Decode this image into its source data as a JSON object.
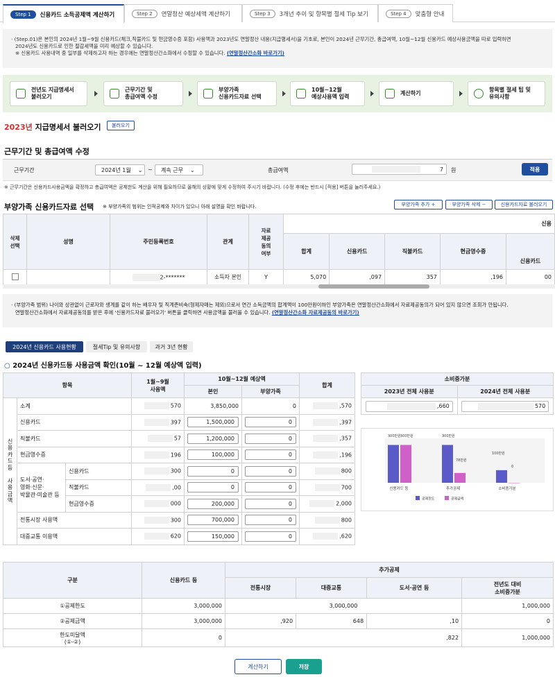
{
  "tabs": [
    {
      "step": "Step 1",
      "label": "신용카드 소득공제액 계산하기"
    },
    {
      "step": "Step 2",
      "label": "연말정산 예상세액 계산하기"
    },
    {
      "step": "Step 3",
      "label": "3개년 추이 및 항목별 절세 Tip 보기"
    },
    {
      "step": "Step 4",
      "label": "맞춤형 안내"
    }
  ],
  "notice": {
    "line1": "· (Step.01)은 본인의 2024년 1월~9월 신용카드(체크,직불카드 및 현금영수증 포함) 사용액과 2023년도 연말정산 내용(지급명세서)을 기초로, 본인이 2024년 근무기간, 총급여액, 10월~12월 신용카드 예상사용금액을 따로 입력하면",
    "line2": "2024년도 신용카드로 인한 절감세액을 미리 예상할 수 있습니다.",
    "line3": "※ 신용카드 사용내역 중 일부를 삭제하고자 하는 경우에는 연말정산간소화에서 수정할 수 있습니다.",
    "link": "(연말정산간소화 바로가기)"
  },
  "flow": [
    {
      "l1": "전년도 지급명세서",
      "l2": "불러오기"
    },
    {
      "l1": "근무기간 및",
      "l2": "총급여액 수정"
    },
    {
      "l1": "부양가족",
      "l2": "신용카드자료 선택"
    },
    {
      "l1": "10월~12월",
      "l2": "예상사용액 입력"
    },
    {
      "l1": "계산하기",
      "l2": ""
    },
    {
      "l1": "항목별 절세 팁 및",
      "l2": "유의사항"
    }
  ],
  "sec1": {
    "year": "2023년",
    "title": " 지급명세서 불러오기",
    "button": "불러오기"
  },
  "sec2": {
    "title": "근무기간 및 총급여액 수정",
    "period_label": "근무기간",
    "period_from": "2024년 1월",
    "tilde": "~",
    "period_to": "계속 근무",
    "salary_label": "총급여액",
    "salary_value": "7",
    "salary_unit": "원",
    "apply": "적용",
    "note": "※ 근무기간은 신용카드사용금액을 확정하고 총급여액은 공제한도 계산을 위해 필요하므로 올해의 상황에 맞게 수정하여 주시기 바랍니다. (수정 후에는 반드시 [적용] 버튼을 눌러주세요.)"
  },
  "sec3": {
    "title": "부양가족 신용카드자료 선택",
    "subnote": "※ 부양가족의 범위는 인적공제와 차이가 있으니 아래 설명을 확인 바랍니다.",
    "btn_add": "부양가족 추가 +",
    "btn_del": "부양가족 삭제 −",
    "btn_load": "신용카드자료 불러오기",
    "headers": {
      "del": "삭제\n선택",
      "name": "성명",
      "rrn": "주민등록번호",
      "rel": "관계",
      "consent": "자료\n제공\n동의\n여부",
      "sum": "합계",
      "credit": "신용카드",
      "debit": "직불카드",
      "cash": "현금영수증",
      "credit2": "신용카드",
      "group": "신용"
    },
    "row": {
      "rrn": "2-*******",
      "rel": "소득자 본인",
      "consent": "Y",
      "sum": "5,070",
      "credit": ",097",
      "debit": "357",
      "cash": ",196",
      "credit2": "00"
    }
  },
  "note2": {
    "line1": "· (부양가족 범위) 나이와 상관없이 근로자와 생계를 같이 하는 배우자 및 직계존비속(형제자매는 제외)으로서 연간 소득금액의 합계액이 100만원이하인 부양가족은 연말정산간소화에서 자료제공동의가 되어 있지 않으면 조회가 안됩니다.",
    "line2": "연말정산간소화에서 자료제공동의를 받은 후에 '신용카드자료 불러오기' 버튼을 클릭하면 사용금액을 불러올 수 있습니다.",
    "link": "(연말정산간소화 자료제공동의 바로가기)"
  },
  "subtabs": [
    "2024년 신용카드 사용현황",
    "절세Tip 및 유의사항",
    "과거 3년 현황"
  ],
  "sec4": {
    "title": "2024년 신용카드등 사용금액 확인(10월 ~ 12월 예상액 입력)",
    "h_item": "항목",
    "h_jan": "1월~9월\n사용액",
    "h_oct": "10월~12월 예상액",
    "h_self": "본인",
    "h_fam": "부양가족",
    "h_total": "합계",
    "side": "신\n용\n카\n드\n등\n\n사\n용\n금\n액",
    "rows": [
      {
        "label": "소계",
        "sub": "",
        "jan": "570",
        "self": "3,850,000",
        "fam": "0",
        "total": ",570",
        "input": false
      },
      {
        "label": "신용카드",
        "sub": "",
        "jan": "397",
        "self": "1,500,000",
        "fam": "0",
        "total": ",397",
        "input": true
      },
      {
        "label": "직불카드",
        "sub": "",
        "jan": "57",
        "self": "1,200,000",
        "fam": "0",
        "total": ",357",
        "input": true
      },
      {
        "label": "현금영수증",
        "sub": "",
        "jan": "196",
        "self": "100,000",
        "fam": "0",
        "total": ",196",
        "input": true
      },
      {
        "label": "",
        "sub": "신용카드",
        "jan": "300",
        "self": "0",
        "fam": "0",
        "total": "800",
        "input": true
      },
      {
        "label": "",
        "sub": "직불카드",
        "jan": ",00",
        "self": "0",
        "fam": "0",
        "total": "700",
        "input": true
      },
      {
        "label": "",
        "sub": "현금영수증",
        "jan": "000",
        "self": "200,000",
        "fam": "0",
        "total": "2,000",
        "input": true
      },
      {
        "label": "전통시장 사용액",
        "sub": "",
        "jan": "300",
        "self": "700,000",
        "fam": "0",
        "total": "800",
        "input": true
      },
      {
        "label": "대중교통 이용액",
        "sub": "",
        "jan": "620",
        "self": "150,000",
        "fam": "0",
        "total": ",620",
        "input": true
      }
    ],
    "culture": "도서·공연·\n영화·신문·\n박물관·미술관 등"
  },
  "consume": {
    "title": "소비증가분",
    "h2023": "2023년 전체 사용분",
    "h2024": "2024년 전체 사용분",
    "v2023": ",660",
    "v2024": "570"
  },
  "chart_data": {
    "type": "bar",
    "categories": [
      "신용카드 등",
      "추가공제",
      "소비증가분"
    ],
    "series": [
      {
        "name": "공제한도",
        "values": [
          300,
          300,
          100
        ],
        "color": "#5a5ac8"
      },
      {
        "name": "공제금액",
        "values": [
          300,
          78,
          0
        ],
        "color": "#d060c8"
      }
    ],
    "labels": [
      "300만원",
      "300만원",
      "300만원",
      "78만원",
      "100만원",
      "0"
    ],
    "ylim": [
      0,
      330
    ]
  },
  "sec5": {
    "h_div": "구분",
    "h_card": "신용카드 등",
    "h_extra": "추가공제",
    "h_market": "전통시장",
    "h_transit": "대중교통",
    "h_book": "도서·공연 등",
    "h_growth": "전년도 대비\n소비증가분",
    "rows": [
      {
        "label": "①공제한도",
        "card": "3,000,000",
        "market": "",
        "transit": "3,000,000",
        "book": "",
        "growth": "1,000,000"
      },
      {
        "label": "②공제금액",
        "card": "3,000,000",
        "market": ",920",
        "transit": "648",
        "book": ",10",
        "growth": "0"
      },
      {
        "label": "한도미달액\n(①-②)",
        "card": "0",
        "market": "",
        "transit": ",822",
        "book": "",
        "growth": "1,000,000"
      }
    ]
  },
  "footer": {
    "calc": "계산하기",
    "save": "저장"
  }
}
